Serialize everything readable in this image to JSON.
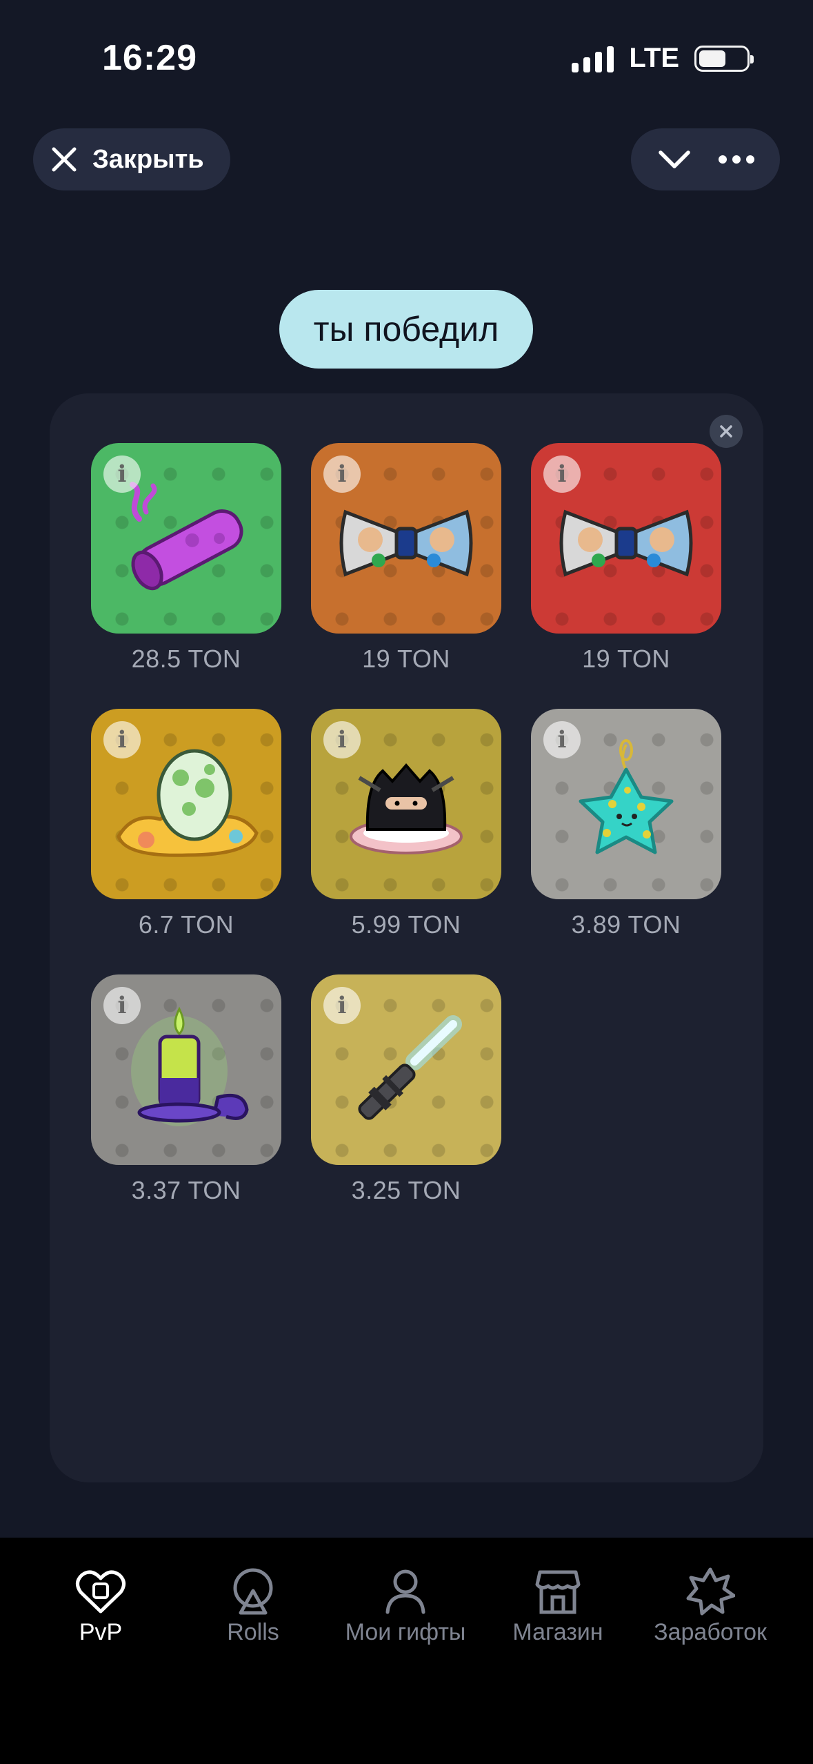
{
  "status_bar": {
    "time": "16:29",
    "network": "LTE"
  },
  "header": {
    "close_label": "Закрыть",
    "collapse_icon": "chevron-down-icon",
    "more_icon": "more-dots-icon"
  },
  "banner": {
    "text": "ты победил"
  },
  "gifts": [
    {
      "price": "28.5 TON",
      "bg": "#4cb865",
      "item": "purple-cigar"
    },
    {
      "price": "19 TON",
      "bg": "#c7702e",
      "item": "bow-tie"
    },
    {
      "price": "19 TON",
      "bg": "#cc3a35",
      "item": "bow-tie"
    },
    {
      "price": "6.7 TON",
      "bg": "#cc9d22",
      "item": "egg-nest"
    },
    {
      "price": "5.99 TON",
      "bg": "#b8a33d",
      "item": "ninja-mochi"
    },
    {
      "price": "3.89 TON",
      "bg": "#a2a19d",
      "item": "star-plush"
    },
    {
      "price": "3.37 TON",
      "bg": "#8d8c89",
      "item": "candle"
    },
    {
      "price": "3.25 TON",
      "bg": "#c7b258",
      "item": "light-sword"
    }
  ],
  "nav": [
    {
      "label": "PvP",
      "icon": "heart-icon",
      "active": true
    },
    {
      "label": "Rolls",
      "icon": "rolls-icon",
      "active": false
    },
    {
      "label": "Мои гифты",
      "icon": "user-icon",
      "active": false
    },
    {
      "label": "Магазин",
      "icon": "shop-icon",
      "active": false
    },
    {
      "label": "Заработок",
      "icon": "star-burst-icon",
      "active": false
    }
  ]
}
